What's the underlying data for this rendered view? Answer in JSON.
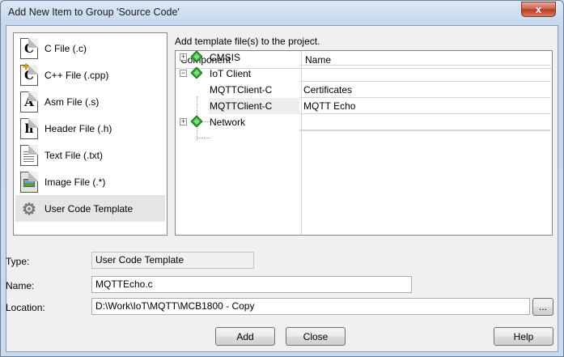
{
  "window": {
    "title": "Add New Item to Group 'Source Code'",
    "close_glyph": "x"
  },
  "file_types": [
    {
      "icon": "c-file-icon",
      "glyph": "C",
      "label": "C File (.c)"
    },
    {
      "icon": "cpp-file-icon",
      "glyph": "C",
      "label": "C++ File (.cpp)"
    },
    {
      "icon": "asm-file-icon",
      "glyph": "A",
      "label": "Asm File (.s)"
    },
    {
      "icon": "header-file-icon",
      "glyph": "h",
      "label": "Header File (.h)"
    },
    {
      "icon": "text-file-icon",
      "glyph": "",
      "label": "Text File (.txt)"
    },
    {
      "icon": "image-file-icon",
      "glyph": "",
      "label": "Image File (.*)"
    },
    {
      "icon": "user-code-template-icon",
      "glyph": "⚙",
      "label": "User Code Template"
    }
  ],
  "selected_file_type": "User Code Template",
  "hint": "Add template file(s) to the project.",
  "grid": {
    "headers": {
      "component": "Component",
      "name": "Name"
    },
    "rows": [
      {
        "component": "CMSIS",
        "name": "",
        "expander": "+"
      },
      {
        "component": "IoT Client",
        "name": "",
        "expander": "−"
      },
      {
        "component": "MQTTClient-C",
        "name": "Certificates",
        "expander": ""
      },
      {
        "component": "MQTTClient-C",
        "name": "MQTT Echo",
        "expander": ""
      },
      {
        "component": "Network",
        "name": "",
        "expander": "+"
      }
    ]
  },
  "form": {
    "type_label": "Type:",
    "type_value": "User Code Template",
    "name_label": "Name:",
    "name_value": "MQTTEcho.c",
    "location_label": "Location:",
    "location_value": "D:\\Work\\IoT\\MQTT\\MCB1800 - Copy",
    "browse_label": "..."
  },
  "buttons": {
    "add": "Add",
    "close": "Close",
    "help": "Help"
  },
  "colors": {
    "component_icon": "#2fa52f",
    "title_bar": "#c9dbee",
    "close_button": "#c75a44"
  }
}
